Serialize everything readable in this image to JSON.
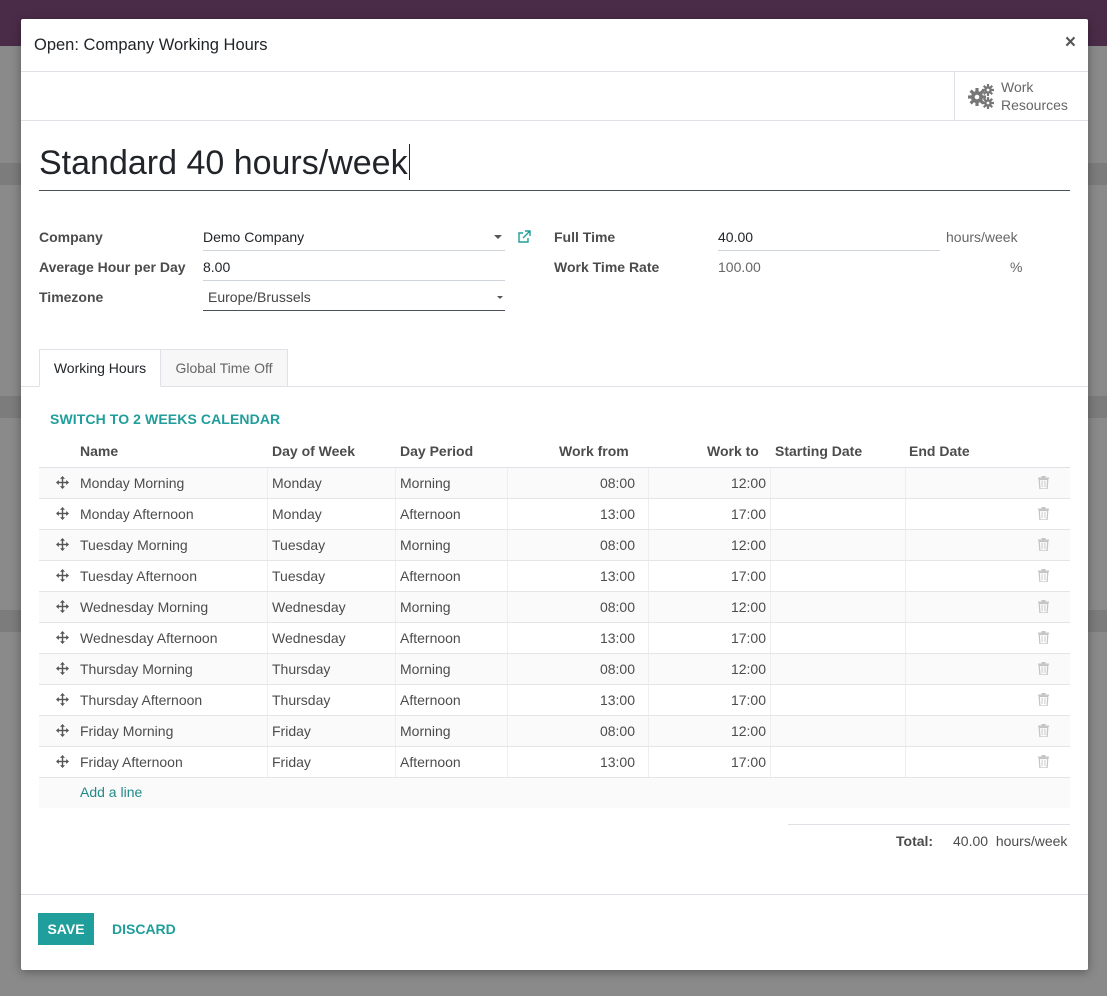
{
  "dialog": {
    "title": "Open: Company Working Hours",
    "close_label": "×"
  },
  "button_box": {
    "work_resources_line1": "Work",
    "work_resources_line2": "Resources",
    "icon": "gears-icon"
  },
  "record": {
    "name": "Standard 40 hours/week"
  },
  "fields": {
    "company_label": "Company",
    "company_value": "Demo Company",
    "avg_hour_label": "Average Hour per Day",
    "avg_hour_value": "8.00",
    "timezone_label": "Timezone",
    "timezone_value": "Europe/Brussels",
    "full_time_label": "Full Time",
    "full_time_value": "40.00",
    "full_time_unit": "hours/week",
    "work_time_rate_label": "Work Time Rate",
    "work_time_rate_value": "100.00",
    "work_time_rate_unit": "%"
  },
  "tabs": [
    {
      "label": "Working Hours",
      "active": true
    },
    {
      "label": "Global Time Off",
      "active": false
    }
  ],
  "switch_calendar_label": "SWITCH TO 2 WEEKS CALENDAR",
  "table": {
    "columns": [
      "Name",
      "Day of Week",
      "Day Period",
      "Work from",
      "Work to",
      "Starting Date",
      "End Date"
    ],
    "rows": [
      {
        "name": "Monday Morning",
        "day": "Monday",
        "period": "Morning",
        "from": "08:00",
        "to": "12:00",
        "start": "",
        "end": ""
      },
      {
        "name": "Monday Afternoon",
        "day": "Monday",
        "period": "Afternoon",
        "from": "13:00",
        "to": "17:00",
        "start": "",
        "end": ""
      },
      {
        "name": "Tuesday Morning",
        "day": "Tuesday",
        "period": "Morning",
        "from": "08:00",
        "to": "12:00",
        "start": "",
        "end": ""
      },
      {
        "name": "Tuesday Afternoon",
        "day": "Tuesday",
        "period": "Afternoon",
        "from": "13:00",
        "to": "17:00",
        "start": "",
        "end": ""
      },
      {
        "name": "Wednesday Morning",
        "day": "Wednesday",
        "period": "Morning",
        "from": "08:00",
        "to": "12:00",
        "start": "",
        "end": ""
      },
      {
        "name": "Wednesday Afternoon",
        "day": "Wednesday",
        "period": "Afternoon",
        "from": "13:00",
        "to": "17:00",
        "start": "",
        "end": ""
      },
      {
        "name": "Thursday Morning",
        "day": "Thursday",
        "period": "Morning",
        "from": "08:00",
        "to": "12:00",
        "start": "",
        "end": ""
      },
      {
        "name": "Thursday Afternoon",
        "day": "Thursday",
        "period": "Afternoon",
        "from": "13:00",
        "to": "17:00",
        "start": "",
        "end": ""
      },
      {
        "name": "Friday Morning",
        "day": "Friday",
        "period": "Morning",
        "from": "08:00",
        "to": "12:00",
        "start": "",
        "end": ""
      },
      {
        "name": "Friday Afternoon",
        "day": "Friday",
        "period": "Afternoon",
        "from": "13:00",
        "to": "17:00",
        "start": "",
        "end": ""
      }
    ],
    "add_line_label": "Add a line"
  },
  "total": {
    "label": "Total:",
    "value": "40.00",
    "unit": "hours/week"
  },
  "footer": {
    "save_label": "SAVE",
    "discard_label": "DISCARD"
  },
  "colors": {
    "accent": "#1f9e9b",
    "topbar": "#4b2c48"
  }
}
